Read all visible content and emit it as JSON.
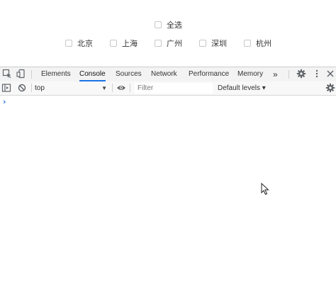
{
  "page": {
    "select_all": "全选",
    "cities": [
      "北京",
      "上海",
      "广州",
      "深圳",
      "杭州"
    ]
  },
  "devtools": {
    "tabs": [
      "Elements",
      "Console",
      "Sources",
      "Network",
      "Performance",
      "Memory"
    ],
    "active_tab": "Console",
    "more_tabs": "»",
    "context": "top",
    "filter_placeholder": "Filter",
    "levels": "Default levels ▾",
    "prompt": "›"
  },
  "colors": {
    "accent": "#1a73e8"
  }
}
